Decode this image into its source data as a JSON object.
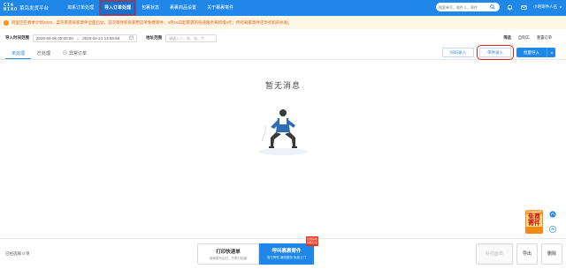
{
  "app": {
    "logo_mark": "CIA\nNIAO",
    "logo_text": "菜鸟发货平台"
  },
  "nav": {
    "items": [
      {
        "label": "淘系订单处理",
        "active": false
      },
      {
        "label": "导入订单处理",
        "active": true
      },
      {
        "label": "包裹状态",
        "active": false
      },
      {
        "label": "裹裹商品设置",
        "active": false
      },
      {
        "label": "关于裹裹寄件",
        "active": false
      }
    ]
  },
  "header": {
    "search_placeholder": "搜索单号，收件人，寄件",
    "user_name": "小明寄件人名"
  },
  "notice": {
    "text": "阿里巴巴春季计划2020，菜鸟裹裹商家寄件全面启动，首次寄件新商家用首单免费寄件，4月16日起裹裹的快递服务将新增3元；所有商家寄件还享折扣的补贴。"
  },
  "filters": {
    "date_label": "导入时间范围",
    "date_start": "2020-04-06 00:00:00",
    "date_end": "2020-04-21 13:59:59",
    "address_label": "地址范围",
    "address_placeholder": "请输入人、地、电、手"
  },
  "right_links": {
    "a": "筛选",
    "b": "自制工",
    "c": "重置订单"
  },
  "tabs": [
    {
      "label": "未处理",
      "active": true
    },
    {
      "label": "已处理",
      "active": false
    },
    {
      "label": "异常订单",
      "active": false
    }
  ],
  "actions": {
    "scan_import": "扫码录入",
    "single_import": "单件录入",
    "batch_import": "批量导入"
  },
  "empty": {
    "title": "暂无消息"
  },
  "promo": {
    "top": "菜鸟裹裹寄件",
    "big1": "免费",
    "big2": "寄件"
  },
  "footer": {
    "selected": "已经选择 0 项",
    "print_main": "打印快递单",
    "print_sub": "使用菜鸟云打，分享打包装",
    "call_main": "呼叫裹裹寄件",
    "call_sub": "官方寄件 最快服务 免费上门",
    "call_badge": "优惠来啦 领取红包",
    "btn_retrieve": "补打面单",
    "btn_export": "导出",
    "btn_delete": "删除"
  },
  "colors": {
    "brand": "#1f87e8",
    "highlight": "#e02020",
    "notice": "#e8590c"
  }
}
